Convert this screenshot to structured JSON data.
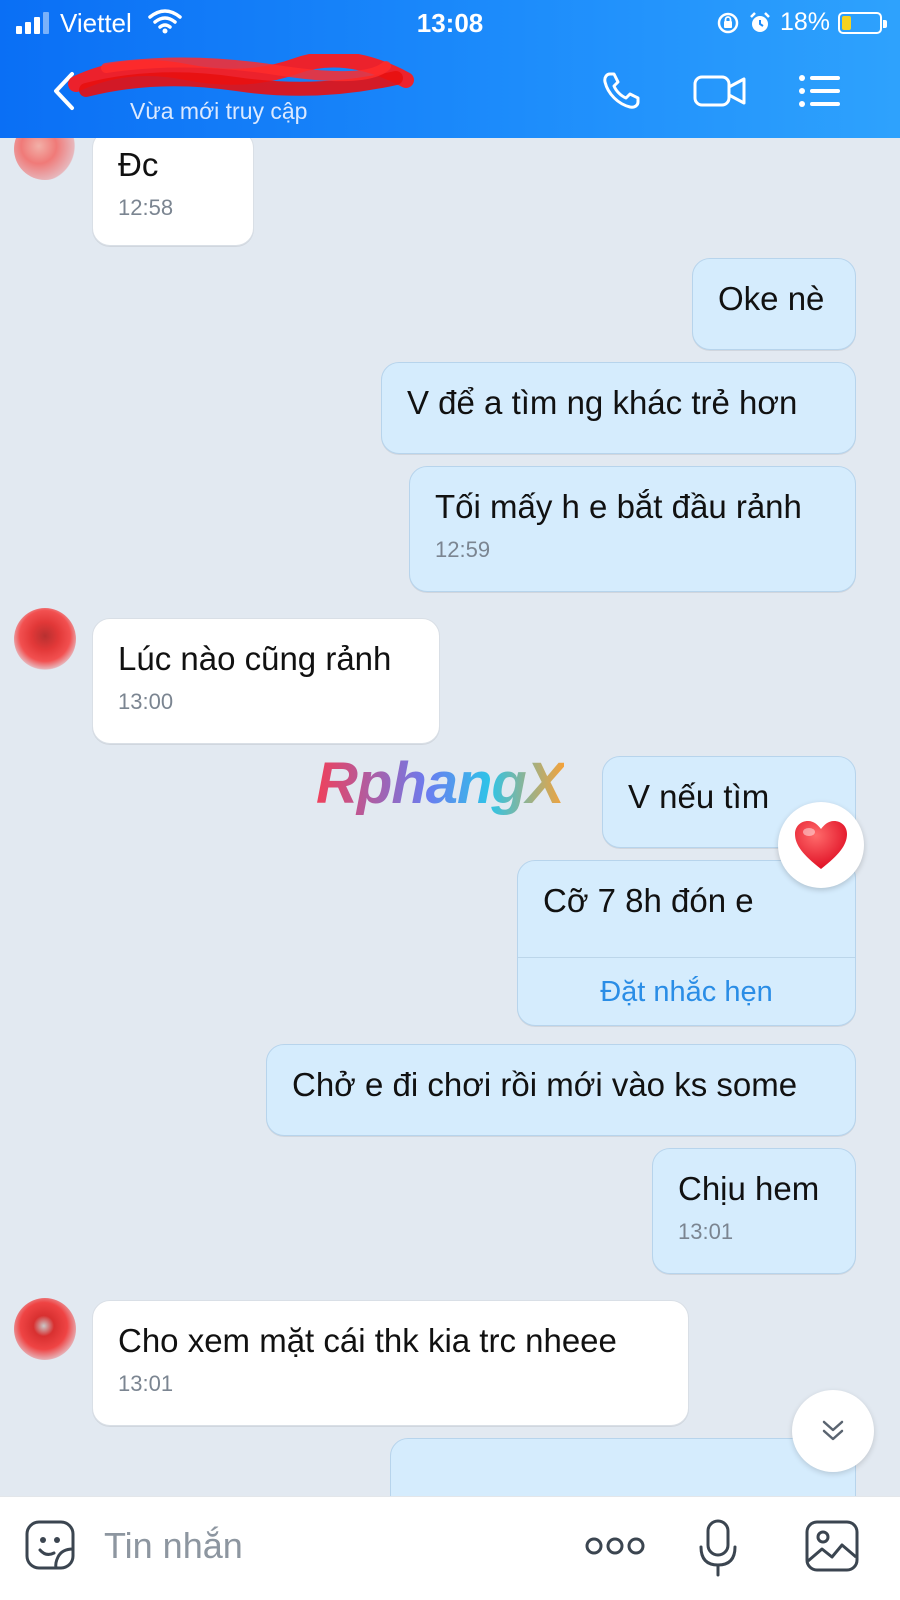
{
  "status_bar": {
    "carrier": "Viettel",
    "time": "13:08",
    "battery": "18%"
  },
  "header": {
    "presence": "Vừa mới truy cập"
  },
  "messages": [
    {
      "side": "in",
      "text": "Đc",
      "time": "12:58"
    },
    {
      "side": "out",
      "text": "Oke nè",
      "time": ""
    },
    {
      "side": "out",
      "text": "V để a tìm ng khác trẻ hơn",
      "time": ""
    },
    {
      "side": "out",
      "text": "Tối mấy h e bắt đầu rảnh",
      "time": "12:59"
    },
    {
      "side": "in",
      "text": "Lúc nào cũng rảnh",
      "time": "13:00"
    },
    {
      "side": "out",
      "text": "V nếu tìm",
      "time": "",
      "reaction": "heart-icon"
    },
    {
      "side": "out",
      "text": "Cỡ 7 8h đón e",
      "time": "",
      "action": "Đặt nhắc hẹn"
    },
    {
      "side": "out",
      "text": "Chở e đi chơi rồi mới vào ks some",
      "time": ""
    },
    {
      "side": "out",
      "text": "Chịu hem",
      "time": "13:01"
    },
    {
      "side": "in",
      "text": "Cho xem mặt cái thk kia trc nheee",
      "time": "13:01"
    }
  ],
  "watermark": "RphangX",
  "composer": {
    "placeholder": "Tin nhắn"
  },
  "icons": {
    "back": "chevron-left-icon",
    "call": "phone-icon",
    "video": "video-camera-icon",
    "menu": "list-icon",
    "sticker": "sticker-icon",
    "more": "more-dots-icon",
    "mic": "microphone-icon",
    "image": "image-icon",
    "scroll": "double-chevron-down-icon"
  },
  "colors": {
    "header": "#0a6ff5",
    "outgoing_bubble": "#d5ecfd",
    "incoming_bubble": "#ffffff",
    "background": "#e2e9f1",
    "action_link": "#2a8de6"
  }
}
